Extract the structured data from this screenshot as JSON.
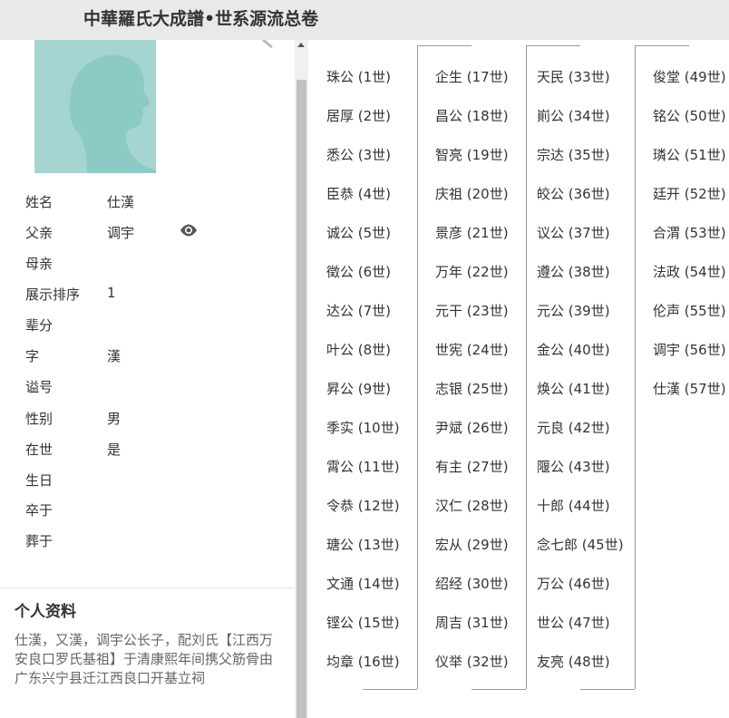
{
  "header": {
    "title": "中華羅氏大成譜•世系源流总卷"
  },
  "person": {
    "fields": [
      {
        "key": "姓名",
        "value": "仕漢"
      },
      {
        "key": "父亲",
        "value": "调宇"
      },
      {
        "key": "母亲",
        "value": ""
      },
      {
        "key": "展示排序",
        "value": "1"
      },
      {
        "key": "辈分",
        "value": ""
      },
      {
        "key": "字",
        "value": "漢"
      },
      {
        "key": "谥号",
        "value": ""
      },
      {
        "key": "性别",
        "value": "男"
      },
      {
        "key": "在世",
        "value": "是"
      },
      {
        "key": "生日",
        "value": ""
      },
      {
        "key": "卒于",
        "value": ""
      },
      {
        "key": "葬于",
        "value": ""
      }
    ]
  },
  "profile": {
    "title": "个人资料",
    "text": "仕漢，又漢，调宇公长子，配刘氏【江西万安良口罗氏基祖】于清康熙年间携父筋骨由广东兴宁县迁江西良口开基立祠"
  },
  "generations": [
    [
      "珠公 (1世)",
      "居厚 (2世)",
      "悉公 (3世)",
      "臣恭 (4世)",
      "诚公 (5世)",
      "徵公 (6世)",
      "达公 (7世)",
      "叶公 (8世)",
      "昇公 (9世)",
      "季实 (10世)",
      "霄公 (11世)",
      "令恭 (12世)",
      "瑭公 (13世)",
      "文通 (14世)",
      "铿公 (15世)",
      "均章 (16世)"
    ],
    [
      "企生 (17世)",
      "昌公 (18世)",
      "智亮 (19世)",
      "庆祖 (20世)",
      "景彦 (21世)",
      "万年 (22世)",
      "元干 (23世)",
      "世宪 (24世)",
      "志银 (25世)",
      "尹斌 (26世)",
      "有主 (27世)",
      "汉仁 (28世)",
      "宏从 (29世)",
      "绍经 (30世)",
      "周吉 (31世)",
      "仪举 (32世)"
    ],
    [
      "天民 (33世)",
      "崱公 (34世)",
      "宗达 (35世)",
      "皎公 (36世)",
      "议公 (37世)",
      "遵公 (38世)",
      "元公 (39世)",
      "金公 (40世)",
      "焕公 (41世)",
      "元良 (42世)",
      "隁公 (43世)",
      "十郎 (44世)",
      "念七郎 (45世)",
      "万公 (46世)",
      "世公 (47世)",
      "友亮 (48世)"
    ],
    [
      "俊堂 (49世)",
      "铭公 (50世)",
      "璘公 (51世)",
      "廷开 (52世)",
      "合渭 (53世)",
      "法政 (54世)",
      "伦声 (55世)",
      "调宇 (56世)",
      "仕漢 (57世)"
    ]
  ]
}
